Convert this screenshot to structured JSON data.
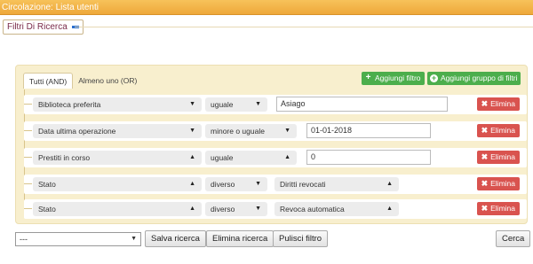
{
  "window": {
    "title": "Circolazione: Lista utenti"
  },
  "filters_tab": {
    "label": "Filtri Di Ricerca"
  },
  "logic_tabs": [
    {
      "label": "Tutti (AND)",
      "active": true
    },
    {
      "label": "Almeno uno (OR)",
      "active": false
    }
  ],
  "actions": {
    "add_filter": "Aggiungi filtro",
    "add_group": "Aggiungi gruppo di filtri"
  },
  "rows": [
    {
      "field": "Biblioteca preferita",
      "field_caret": "▼",
      "operator": "uguale",
      "operator_caret": "▼",
      "value": "Asiago",
      "value_kind": "text",
      "delete": "Elimina"
    },
    {
      "field": "Data ultima operazione",
      "field_caret": "▼",
      "operator": "minore o uguale",
      "operator_caret": "▼",
      "value": "01-01-2018",
      "value_kind": "text",
      "delete": "Elimina"
    },
    {
      "field": "Prestiti in corso",
      "field_caret": "▲",
      "operator": "uguale",
      "operator_caret": "▲",
      "value": "0",
      "value_kind": "text",
      "delete": "Elimina"
    },
    {
      "field": "Stato",
      "field_caret": "▲",
      "operator": "diverso",
      "operator_caret": "▼",
      "value": "Diritti revocati",
      "value_kind": "select",
      "value_caret": "▲",
      "delete": "Elimina"
    },
    {
      "field": "Stato",
      "field_caret": "▲",
      "operator": "diverso",
      "operator_caret": "▼",
      "value": "Revoca automatica",
      "value_kind": "select",
      "value_caret": "▲",
      "delete": "Elimina"
    }
  ],
  "footer": {
    "saved_filter_value": "---",
    "save_search": "Salva ricerca",
    "delete_search": "Elimina ricerca",
    "clear_filter": "Pulisci filtro",
    "search": "Cerca"
  },
  "colors": {
    "title_bar": "#eea83a",
    "panel_bg": "#f8efce",
    "add_green": "#4cae4c",
    "delete_red": "#d9534f"
  }
}
